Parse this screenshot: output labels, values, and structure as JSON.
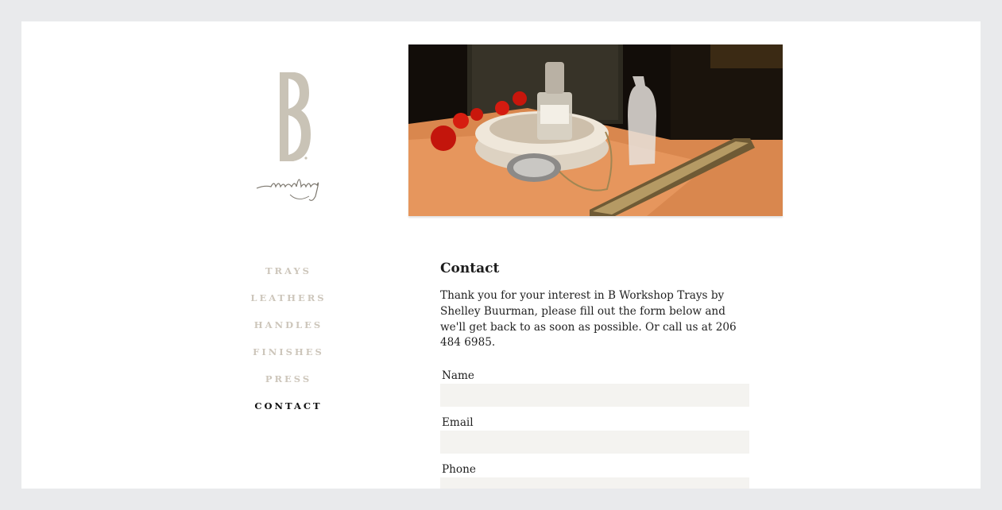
{
  "brand": {
    "logo_letter": "B",
    "logo_script": "workshop",
    "hero_alt": "Marble tray with perfume bottles and jewelry"
  },
  "nav": {
    "items": [
      {
        "label": "TRAYS",
        "active": false
      },
      {
        "label": "LEATHERS",
        "active": false
      },
      {
        "label": "HANDLES",
        "active": false
      },
      {
        "label": "FINISHES",
        "active": false
      },
      {
        "label": "PRESS",
        "active": false
      },
      {
        "label": "CONTACT",
        "active": true
      }
    ]
  },
  "contact": {
    "title": "Contact",
    "intro": "Thank you for your interest in B Workshop Trays by Shelley Buurman, please fill out the form below and we'll get back to as soon as possible. Or call us at 206 484 6985.",
    "fields": [
      {
        "label": "Name",
        "value": ""
      },
      {
        "label": "Email",
        "value": ""
      },
      {
        "label": "Phone",
        "value": ""
      }
    ]
  },
  "colors": {
    "background": "#e9eaec",
    "nav_inactive": "#cdc6bb",
    "nav_active": "#111111",
    "input_bg": "#f4f3f0",
    "logo": "#c9c3b6"
  }
}
